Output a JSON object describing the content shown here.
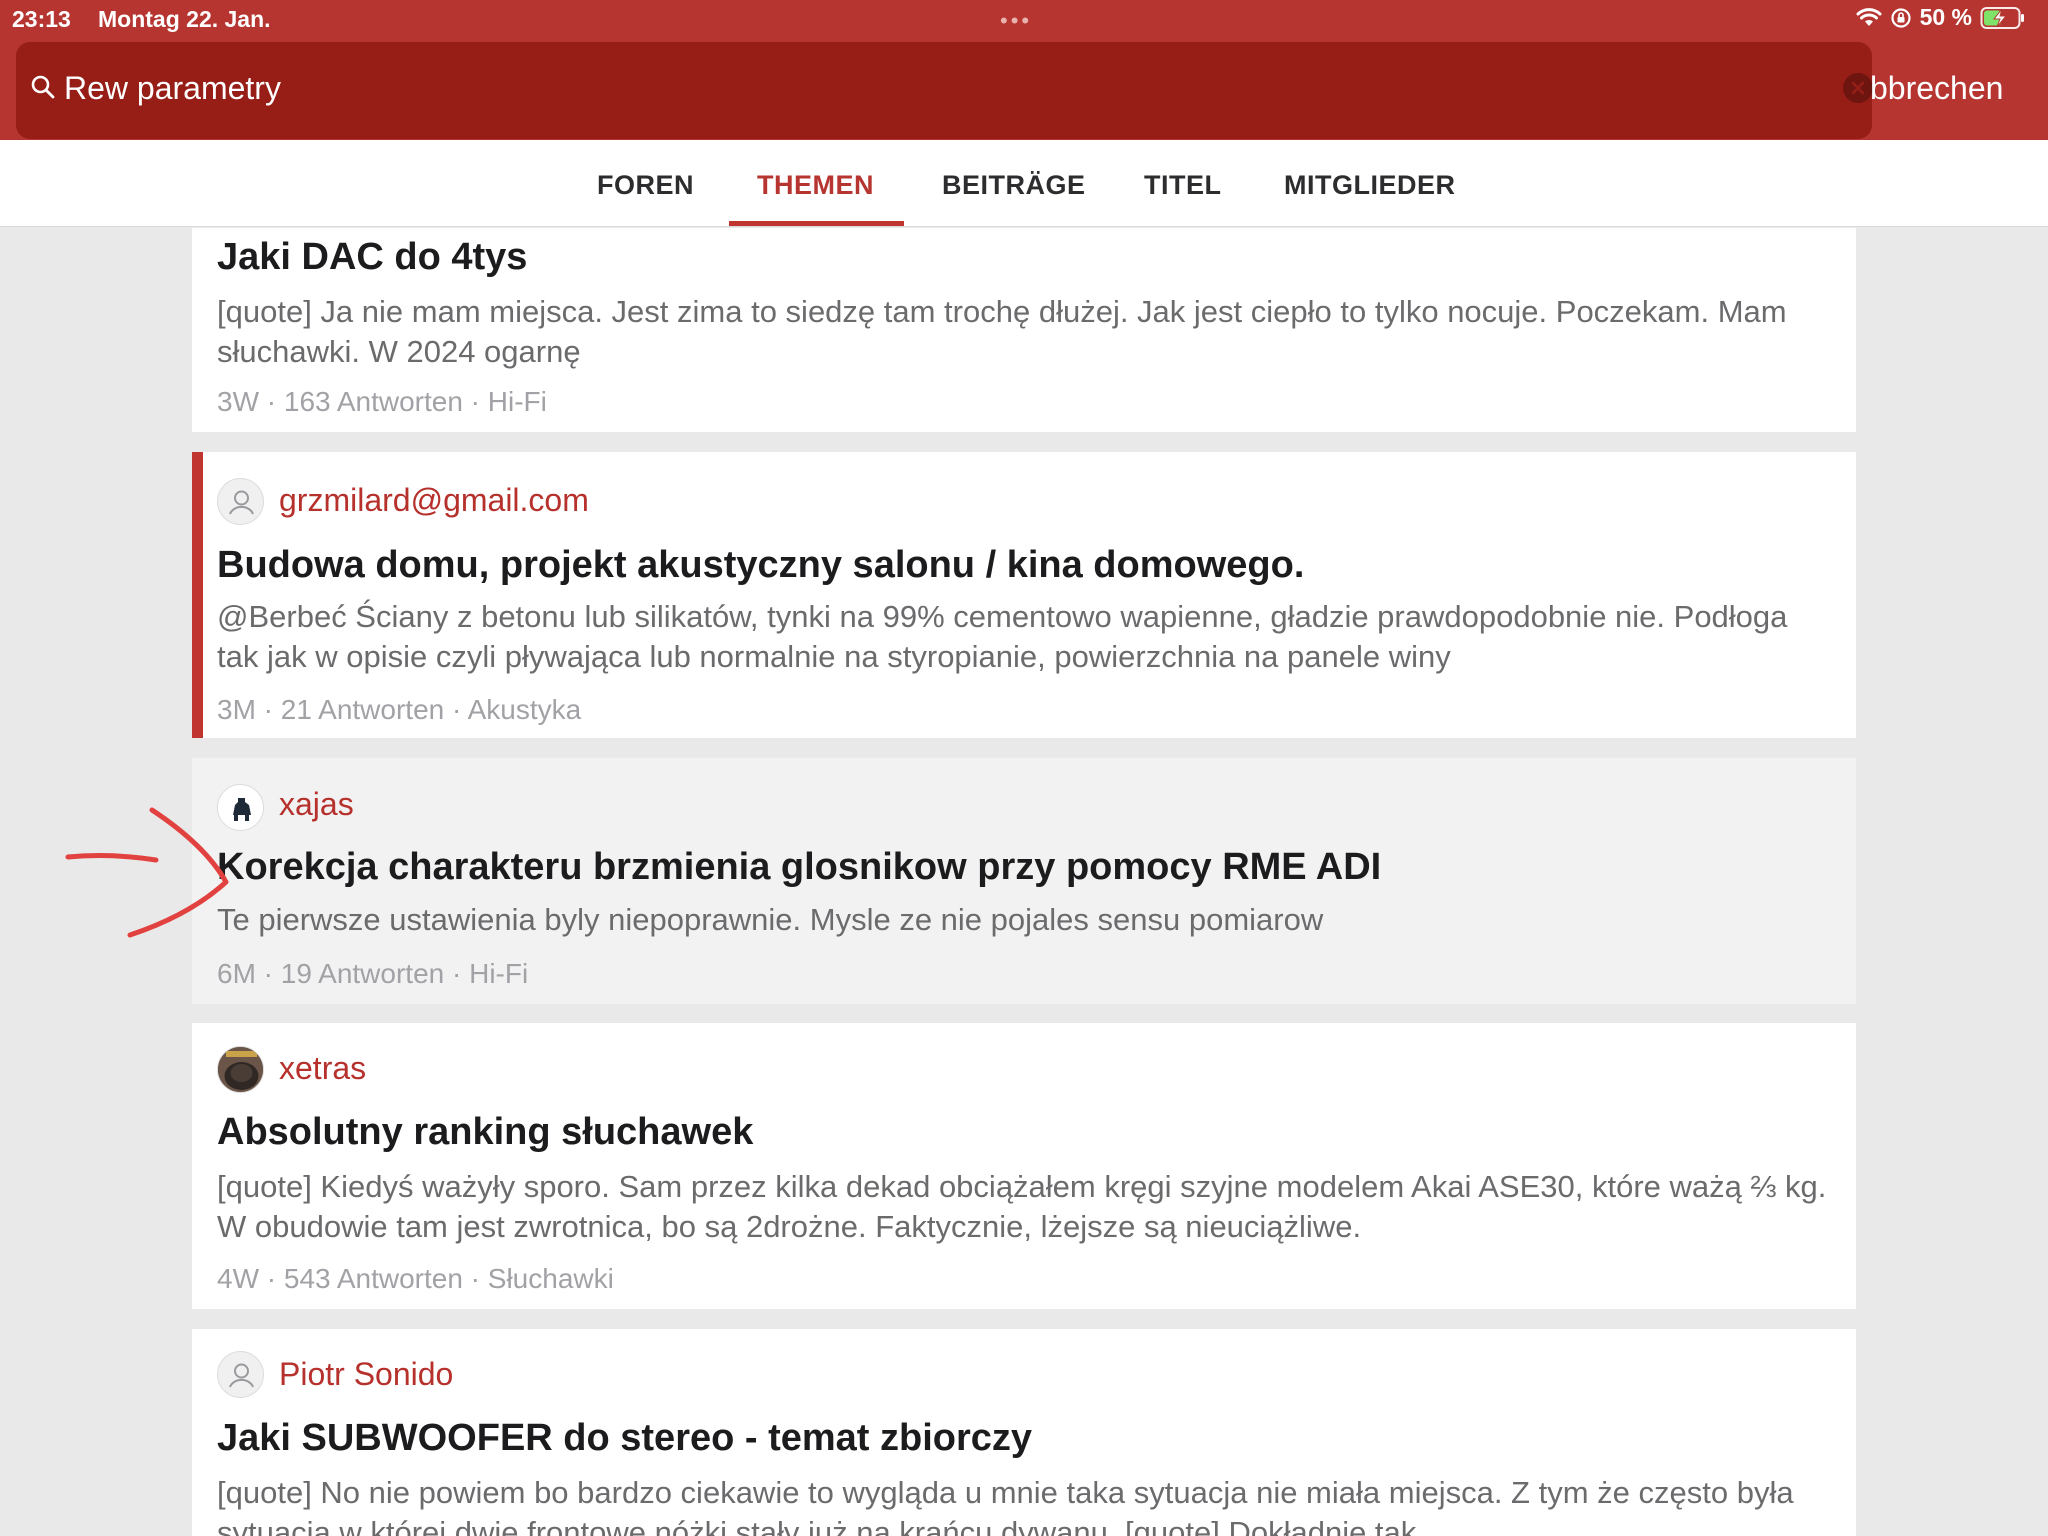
{
  "status_bar": {
    "time": "23:13",
    "date": "Montag 22. Jan.",
    "battery": "50 %",
    "icons": [
      "wifi-icon",
      "orientation-lock-icon",
      "battery-charging-icon"
    ]
  },
  "search": {
    "value": "Rew parametry",
    "cancel_label": "bbrechen"
  },
  "tabs": [
    {
      "label": "FOREN",
      "active": false
    },
    {
      "label": "THEMEN",
      "active": true
    },
    {
      "label": "BEITRÄGE",
      "active": false
    },
    {
      "label": "TITEL",
      "active": false
    },
    {
      "label": "MITGLIEDER",
      "active": false
    }
  ],
  "results": [
    {
      "author": "",
      "title": "Jaki DAC do 4tys",
      "excerpt": "[quote] Ja nie mam miejsca. Jest zima to siedzę tam trochę dłużej. Jak jest ciepło to tylko nocuje. Poczekam. Mam słuchawki.  W 2024 ogarnę",
      "meta": "3W · 163 Antworten · Hi-Fi"
    },
    {
      "author": "grzmilard@gmail.com",
      "avatar": "default-avatar-icon",
      "unread": true,
      "title": "Budowa domu, projekt akustyczny salonu / kina domowego.",
      "excerpt": "@Berbeć Ściany z betonu lub silikatów, tynki na 99% cementowo wapienne, gładzie prawdopodobnie nie. Podłoga tak jak w opisie czyli pływająca lub normalnie na styropianie, powierzchnia na panele winy",
      "meta": "3M · 21 Antworten · Akustyka"
    },
    {
      "author": "xajas",
      "avatar": "user-photo-avatar",
      "highlighted": true,
      "title": "Korekcja charakteru brzmienia glosnikow przy pomocy RME ADI",
      "excerpt": "Te pierwsze ustawienia byly niepoprawnie. Mysle ze nie pojales sensu pomiarow",
      "meta": "6M · 19 Antworten · Hi-Fi"
    },
    {
      "author": "xetras",
      "avatar": "user-photo-avatar",
      "title": "Absolutny ranking słuchawek",
      "excerpt": "[quote] Kiedyś ważyły sporo. Sam przez kilka dekad obciążałem kręgi szyjne modelem Akai ASE30, które ważą ⅔ kg. W obudowie tam jest zwrotnica, bo są 2drożne. Faktycznie, lżejsze są nieuciążliwe.",
      "meta": "4W · 543 Antworten · Słuchawki"
    },
    {
      "author": "Piotr Sonido",
      "avatar": "default-avatar-icon",
      "title": "Jaki SUBWOOFER do stereo - temat zbiorczy",
      "excerpt": "[quote] No nie powiem bo bardzo ciekawie to wygląda u mnie taka sytuacja nie miała miejsca. Z tym że często była sytuacja w której dwie frontowe nóżki stały już na krańcu dywanu. [quote] Dokładnie tak",
      "meta": ""
    }
  ],
  "colors": {
    "accent": "#b63530",
    "search_field": "#961e17",
    "username": "#b6302c",
    "annotation": "#e2423f"
  }
}
